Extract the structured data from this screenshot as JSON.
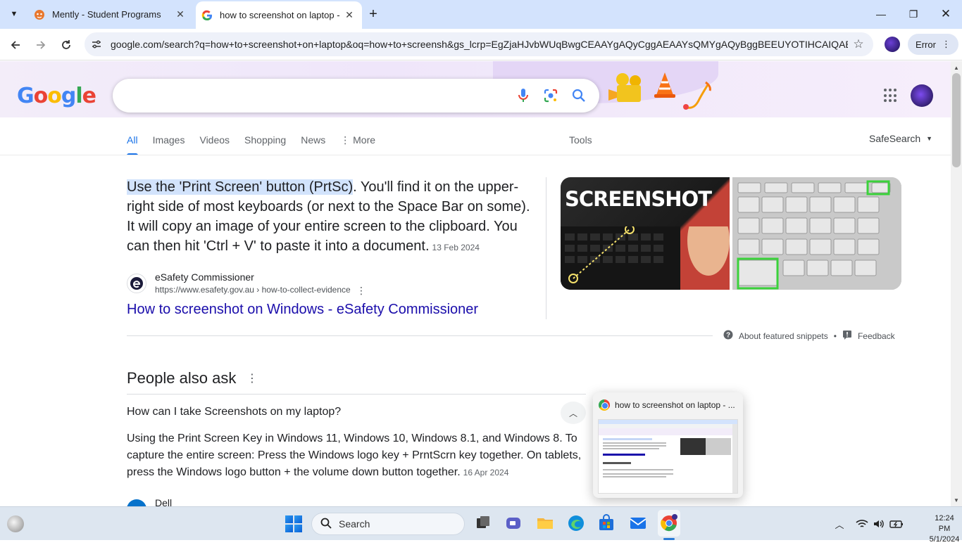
{
  "browser": {
    "tabs": [
      {
        "title": "Mently - Student Programs",
        "active": false,
        "icon": "mently-fox-icon"
      },
      {
        "title": "how to screenshot on laptop -",
        "active": true,
        "icon": "google-g-icon"
      }
    ],
    "address_url": "google.com/search?q=how+to+screenshot+on+laptop&oq=how+to+screensh&gs_lcrp=EgZjaHJvbWUqBwgCEAAYgAQyCggAEAAYsQMYgAQyBggBEEUYOTIHCAIQABi...",
    "error_label": "Error"
  },
  "google": {
    "logo_letters": [
      "G",
      "o",
      "o",
      "g",
      "l",
      "e"
    ],
    "search_value": "",
    "nav_tabs": [
      "All",
      "Images",
      "Videos",
      "Shopping",
      "News",
      "More"
    ],
    "tools_label": "Tools",
    "safesearch_label": "SafeSearch",
    "featured": {
      "highlight": "Use the 'Print Screen' button (PrtSc)",
      "text": ". You'll find it on the upper-right side of most keyboards (or next to the Space Bar on some). It will copy an image of your entire screen to the clipboard. You can then hit 'Ctrl + V' to paste it into a document.",
      "date": "13 Feb 2024",
      "source_name": "eSafety Commissioner",
      "source_url": "https://www.esafety.gov.au › how-to-collect-evidence",
      "link_title": "How to screenshot on Windows - eSafety Commissioner",
      "image_text": "SCREENSHOT"
    },
    "snippet_footer": {
      "about_label": "About featured snippets",
      "separator": "•",
      "feedback_label": "Feedback"
    },
    "paa": {
      "title": "People also ask",
      "question": "How can I take Screenshots on my laptop?",
      "answer": "Using the Print Screen Key in Windows 11, Windows 10, Windows 8.1, and Windows 8. To capture the entire screen: Press the Windows logo key + PrntScrn key together. On tablets, press the Windows logo button + the volume down button together.",
      "answer_date": "16 Apr 2024",
      "next_source": "Dell"
    }
  },
  "preview": {
    "title": "how to screenshot on laptop - ..."
  },
  "taskbar": {
    "search_label": "Search",
    "time": "12:24 PM",
    "date": "5/1/2024"
  },
  "colors": {
    "link": "#1a0dab",
    "accent": "#1a73e8",
    "highlight": "#d2e3fc",
    "tabbar": "#d3e3fd"
  }
}
